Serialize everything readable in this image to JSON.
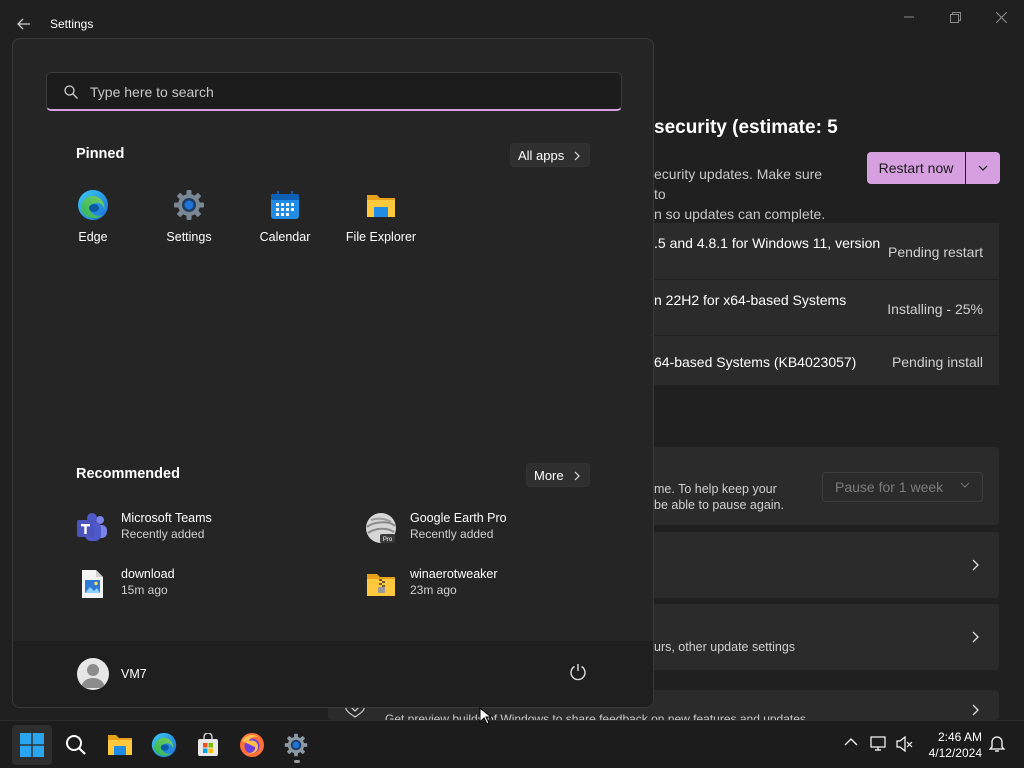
{
  "window": {
    "title": "Settings"
  },
  "settings_page": {
    "heading_fragment": "security (estimate: 5",
    "desc_line1": "ecurity updates. Make sure to",
    "desc_line2": "n so updates can complete.",
    "restart_label": "Restart now",
    "updates": [
      {
        "name": ".5 and 4.8.1 for Windows 11, version",
        "status": "Pending restart"
      },
      {
        "name": "n 22H2 for x64-based Systems",
        "status": "Installing - 25%"
      },
      {
        "name": "64-based Systems (KB4023057)",
        "status": "Pending install"
      }
    ],
    "pause_text_line1": "me. To help keep your",
    "pause_text_line2": "be able to pause again.",
    "pause_select_value": "Pause for 1 week",
    "advanced_text": "urs, other update settings",
    "insider_text": "Get preview builds of Windows to share feedback on new features and updates"
  },
  "start_menu": {
    "search_placeholder": "Type here to search",
    "pinned_title": "Pinned",
    "all_apps_label": "All apps",
    "pinned": [
      {
        "label": "Edge",
        "icon": "edge-icon"
      },
      {
        "label": "Settings",
        "icon": "settings-gear-icon"
      },
      {
        "label": "Calendar",
        "icon": "calendar-icon"
      },
      {
        "label": "File Explorer",
        "icon": "folder-icon"
      }
    ],
    "recommended_title": "Recommended",
    "more_label": "More",
    "recommended": [
      {
        "name": "Microsoft Teams",
        "sub": "Recently added",
        "icon": "teams-icon"
      },
      {
        "name": "Google Earth Pro",
        "sub": "Recently added",
        "icon": "google-earth-icon"
      },
      {
        "name": "download",
        "sub": "15m ago",
        "icon": "image-file-icon"
      },
      {
        "name": "winaerotweaker",
        "sub": "23m ago",
        "icon": "zip-folder-icon"
      }
    ],
    "user_name": "VM7"
  },
  "taskbar": {
    "apps": [
      "start-icon",
      "search-icon",
      "file-explorer-icon",
      "edge-icon",
      "store-icon",
      "firefox-icon",
      "settings-icon"
    ],
    "time": "2:46 AM",
    "date": "4/12/2024"
  },
  "colors": {
    "accent": "#d59fe0",
    "background": "#202020",
    "start_bg": "#252525",
    "card_bg": "#2b2b2b"
  }
}
